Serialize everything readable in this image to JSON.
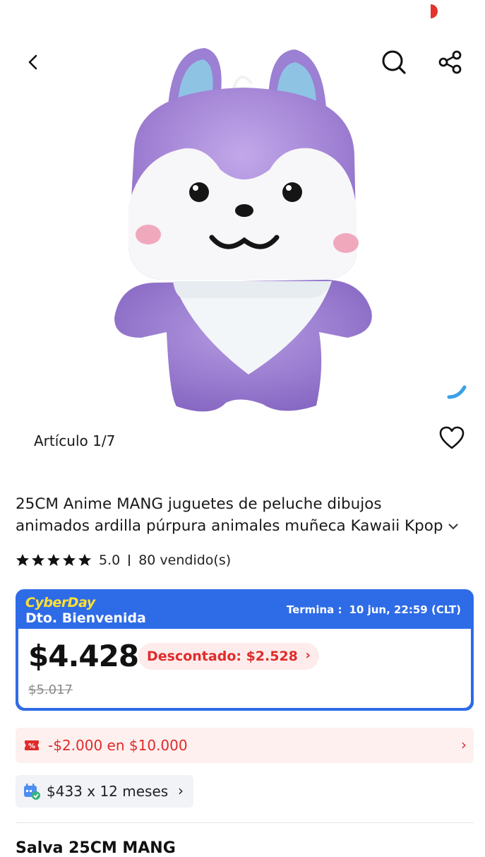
{
  "hero": {
    "image_alt": "Purple plush squirrel toy with white bandana",
    "counter": "Artículo 1/7"
  },
  "icons": {
    "back": "back-arrow-icon",
    "search": "search-icon",
    "share": "share-icon",
    "wishlist": "heart-icon",
    "title_expand": "chevron-down-icon",
    "star": "star-icon",
    "coupon": "coupon-percent-icon",
    "installment": "calendar-card-icon"
  },
  "product": {
    "title_line1": "25CM Anime MANG juguetes de peluche dibujos",
    "title_line2": "animados ardilla púrpura animales muñeca Kawaii Kpop",
    "rating": "5.0",
    "sold": "80 vendido(s)",
    "stars": 5
  },
  "promo": {
    "event": "CyberDay",
    "label": "Dto. Bienvenida",
    "ends_label": "Termina :",
    "ends_value": "10 jun, 22:59 (CLT)",
    "price": "$4.428",
    "discount": "Descontado: $2.528",
    "original_price": "$5.017"
  },
  "coupon": {
    "text": "-$2.000 en $10.000"
  },
  "installment": {
    "text": "$433 x 12 meses"
  },
  "peek_text": "Salva 25CM MANG",
  "colors": {
    "accent_blue": "#2e6be6",
    "discount_red": "#e02b2b",
    "cyber_yellow": "#ffe033",
    "plush_purple": "#a98ad6"
  }
}
